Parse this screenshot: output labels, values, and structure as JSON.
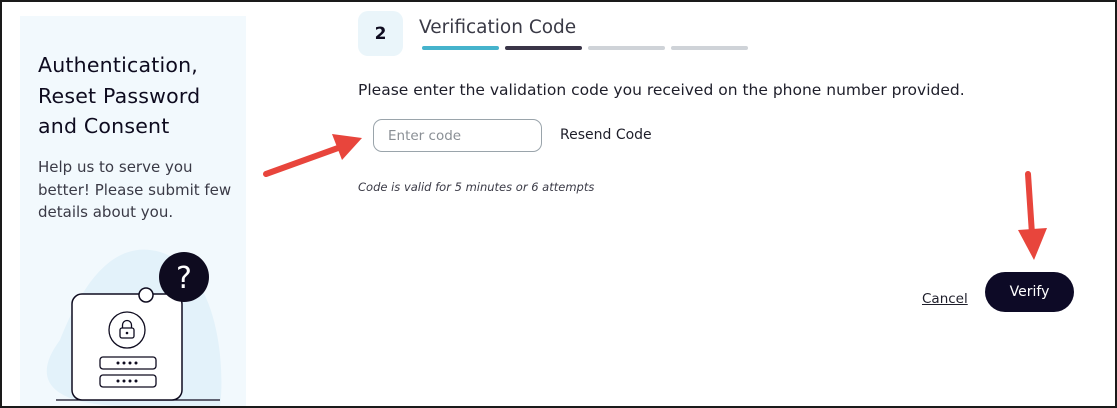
{
  "sidebar": {
    "title": "Authentication, Reset Password and Consent",
    "subtitle": "Help us to serve you better! Please submit few details about you.",
    "illustration_icons": [
      "question-mark-icon",
      "lock-icon",
      "password-dots-icon"
    ]
  },
  "step": {
    "number": "2",
    "title": "Verification Code",
    "progress_colors": [
      "#45b3cc",
      "#3a3548",
      "#cfd3d8",
      "#cfd3d8"
    ]
  },
  "form": {
    "instruction": "Please enter the validation code you received on the phone number provided.",
    "code_placeholder": "Enter code",
    "code_value": "",
    "resend_label": "Resend Code",
    "validity_note": "Code is valid for 5 minutes or 6 attempts"
  },
  "actions": {
    "cancel_label": "Cancel",
    "verify_label": "Verify"
  },
  "colors": {
    "accent": "#45b3cc",
    "primary_button": "#0d0a26",
    "annotation_arrow": "#e8453c"
  }
}
